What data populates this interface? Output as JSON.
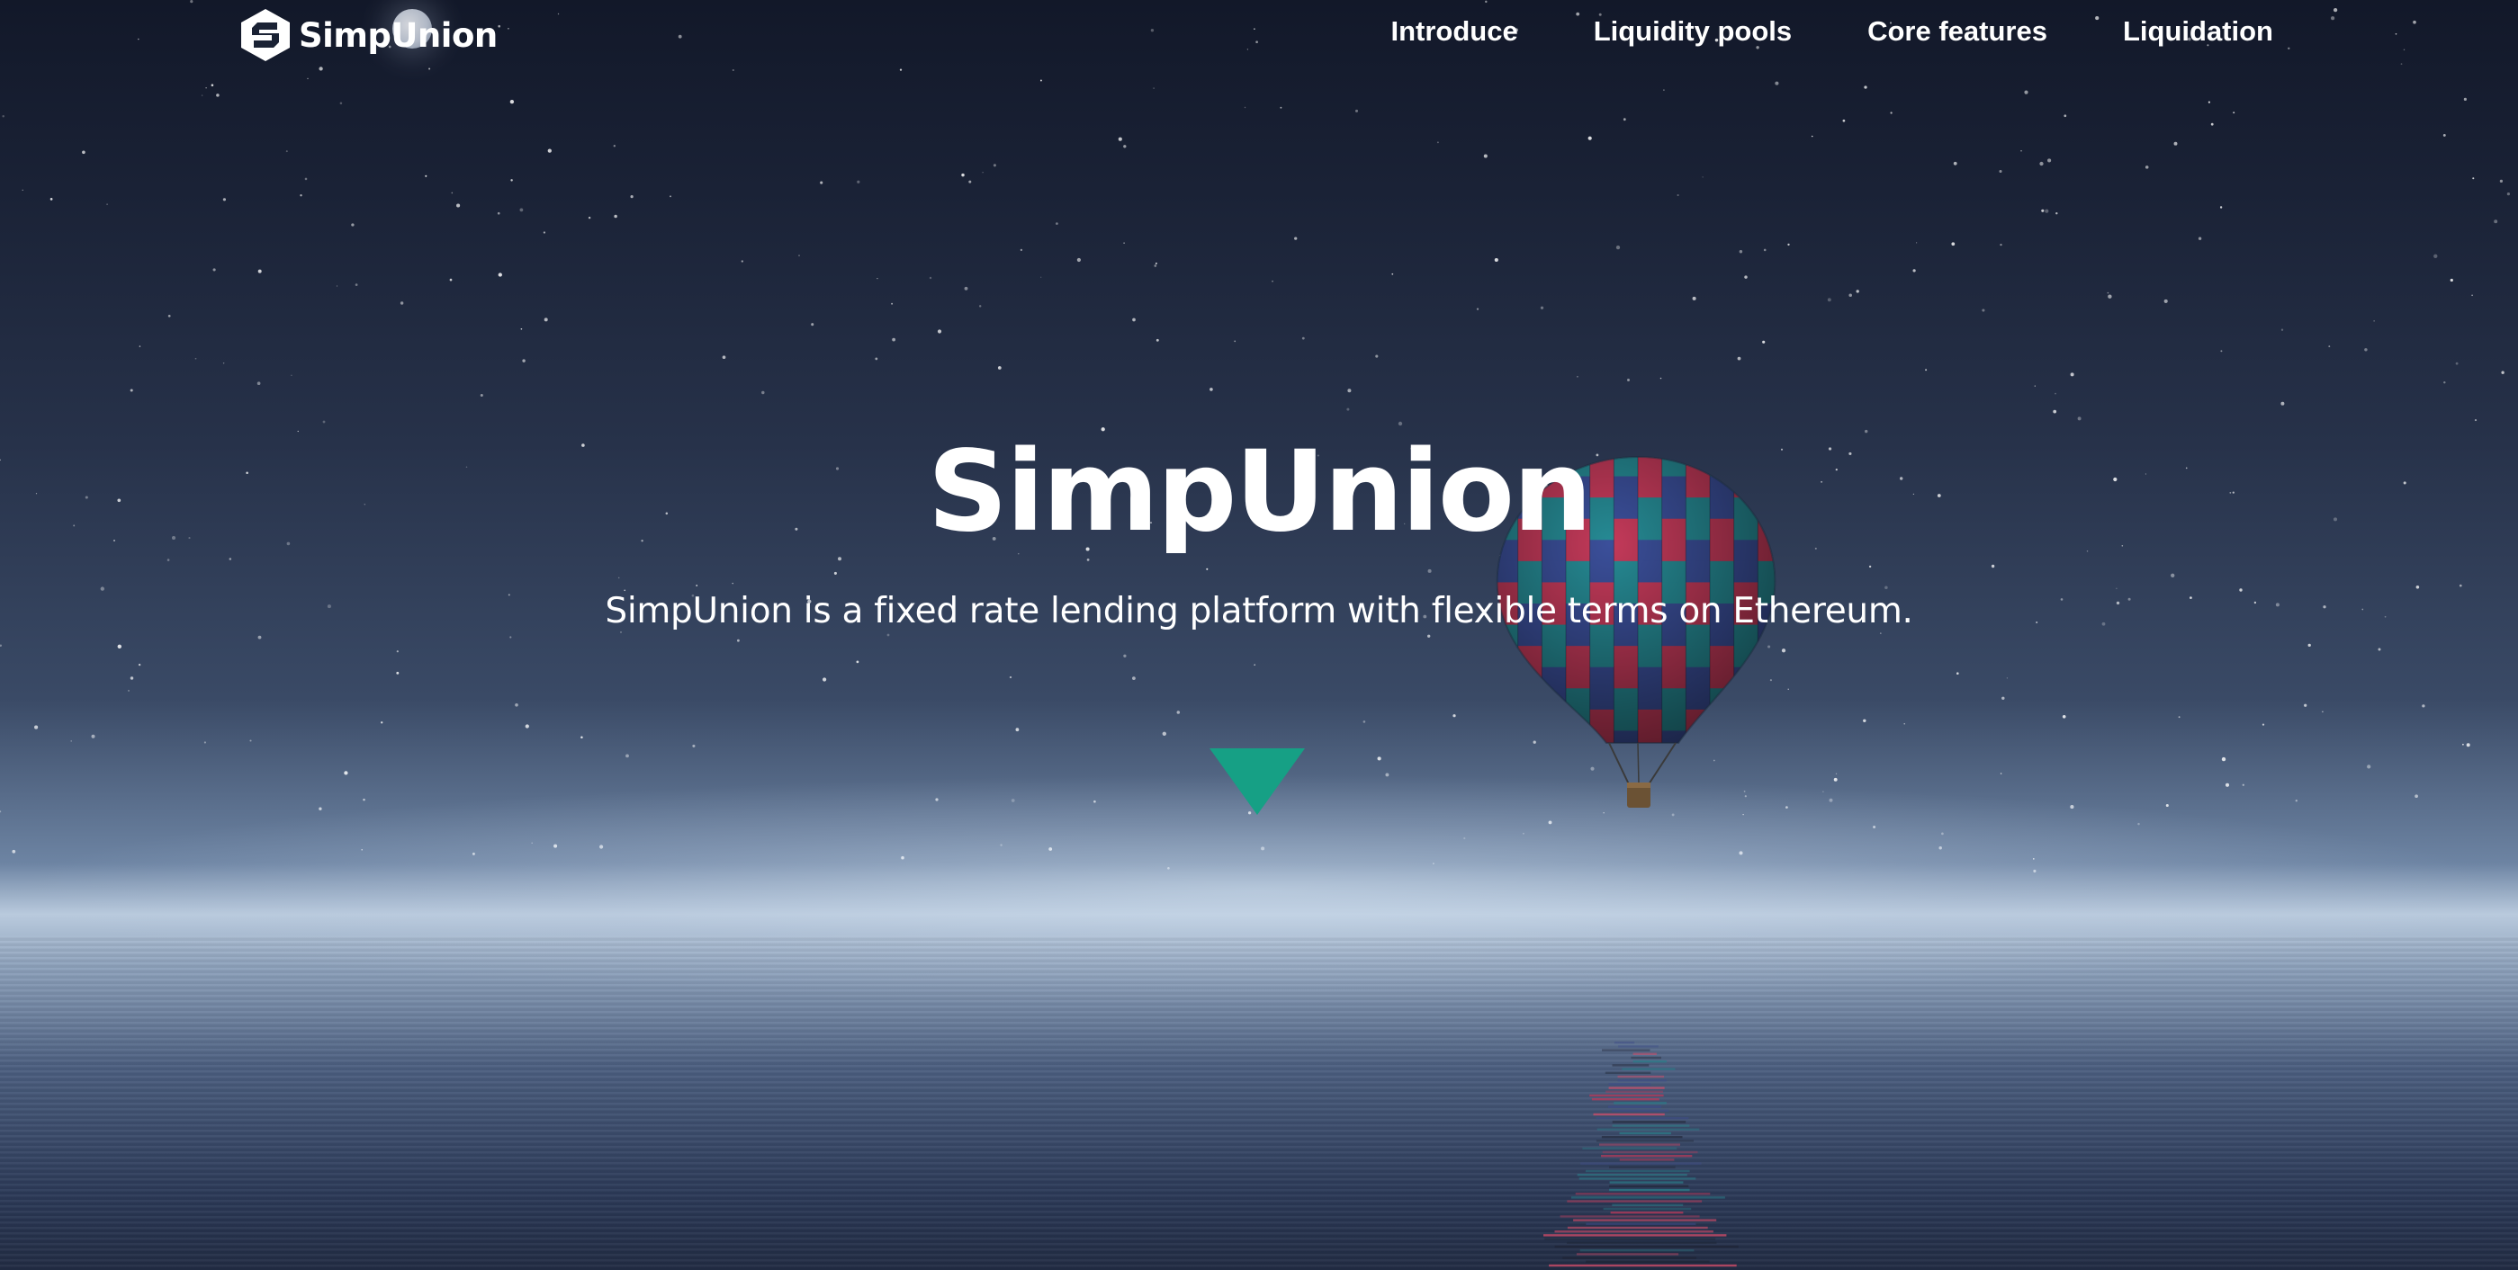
{
  "brand": {
    "name": "SimpUnion",
    "logo_icon": "simpunion-logo-icon"
  },
  "nav": {
    "items": [
      {
        "label": "Introduce"
      },
      {
        "label": "Liquidity pools"
      },
      {
        "label": "Core features"
      },
      {
        "label": "Liquidation"
      }
    ]
  },
  "hero": {
    "title": "SimpUnion",
    "subtitle": "SimpUnion is a fixed rate lending platform with flexible terms on Ethereum.",
    "scroll_icon": "triangle-down-icon"
  },
  "colors": {
    "accent": "#16a085",
    "text": "#ffffff",
    "sky_dark": "#121829"
  }
}
